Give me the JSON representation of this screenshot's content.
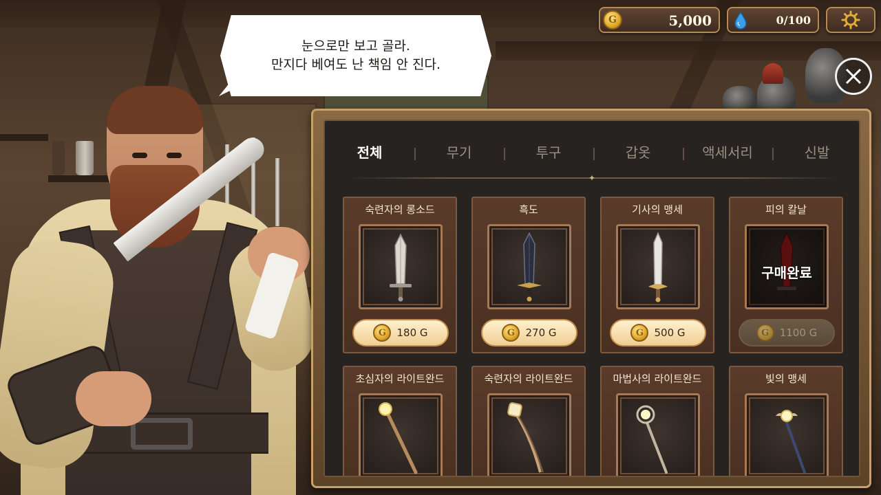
{
  "hud": {
    "gold": "5,000",
    "gold_icon": "gold-coin-icon",
    "mana": "0/100",
    "mana_icon": "blue-drop-icon",
    "settings_icon": "gear-icon",
    "close_icon": "close-icon"
  },
  "npc": {
    "speech_line1": "눈으로만 보고 골라.",
    "speech_line2": "만지다 베여도 난 책임 안 진다."
  },
  "shop": {
    "tabs": [
      {
        "label": "전체",
        "active": true
      },
      {
        "label": "무기",
        "active": false
      },
      {
        "label": "투구",
        "active": false
      },
      {
        "label": "갑옷",
        "active": false
      },
      {
        "label": "액세서리",
        "active": false
      },
      {
        "label": "신발",
        "active": false
      }
    ],
    "coin_glyph": "G",
    "sold_text": "구매완료",
    "items": [
      {
        "name": "숙련자의 롱소드",
        "price": "180 G",
        "icon": "silver-longsword-icon",
        "sold": false
      },
      {
        "name": "흑도",
        "price": "270 G",
        "icon": "black-sword-icon",
        "sold": false
      },
      {
        "name": "기사의 맹세",
        "price": "500 G",
        "icon": "knight-sword-icon",
        "sold": false
      },
      {
        "name": "피의 칼날",
        "price": "1100 G",
        "icon": "blood-blade-icon",
        "sold": true
      },
      {
        "name": "초심자의 라이트완드",
        "icon": "light-wand-icon"
      },
      {
        "name": "숙련자의 라이트완드",
        "icon": "light-wand-icon"
      },
      {
        "name": "마법사의 라이트완드",
        "icon": "ring-wand-icon"
      },
      {
        "name": "빛의 맹세",
        "icon": "winged-wand-icon"
      }
    ]
  },
  "colors": {
    "accent_gold": "#e0a72a",
    "panel_bg": "#272320",
    "card_bg": "#4a3022",
    "price_bg": "#f0cf94",
    "sold_overlay": "#000000"
  }
}
